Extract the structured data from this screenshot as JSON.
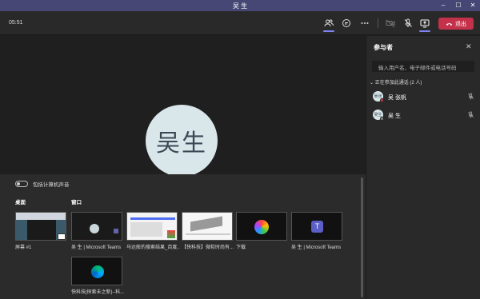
{
  "window": {
    "title": "吴 生"
  },
  "toolbar": {
    "timer": "05:51",
    "leave_label": "退出"
  },
  "stage": {
    "avatar_initials": "吴生"
  },
  "share": {
    "toggle_label": "包括计算机声音",
    "desktop_label": "桌面",
    "window_label": "窗口",
    "items": [
      {
        "label": "屏幕 #1"
      },
      {
        "label": "吴 生 | Microsoft Teams"
      },
      {
        "label": "马达般的搜索结果_百度..."
      },
      {
        "label": "【快科技】微软时尚有..."
      },
      {
        "label": "下载"
      },
      {
        "label": "吴 生 | Microsoft Teams"
      },
      {
        "label": "快科技|探索未之新|--科..."
      }
    ]
  },
  "panel": {
    "title": "参与者",
    "search_placeholder": "输入用户名、电子邮件或电话号码",
    "group_label": "正在参加此通话 (2 人)",
    "participants": [
      {
        "name": "吴 张帆",
        "initials": "吴张",
        "status_color": "#c4314b"
      },
      {
        "name": "吴 生",
        "initials": "吴生",
        "status_color": "#888888"
      }
    ]
  },
  "colors": {
    "titlebar": "#464775",
    "accent": "#7f85f5",
    "leave": "#c4314b"
  }
}
